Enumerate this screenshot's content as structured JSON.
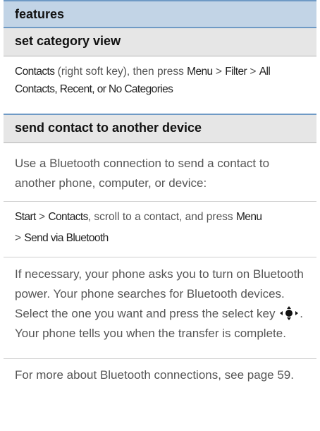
{
  "header": {
    "title": "features"
  },
  "section1": {
    "title": "set category view",
    "line1": {
      "cmd_contacts": "Contacts",
      "t1": " (right soft key), then press ",
      "cmd_menu": "Menu",
      "t2": " > ",
      "cmd_filter": "Filter",
      "t3": " > ",
      "cmd_all": "All"
    },
    "line2": {
      "cmd": "Contacts, Recent, or No Categories"
    }
  },
  "section2": {
    "title": "send contact to another device",
    "p1": "Use a Bluetooth connection to send a contact to another phone, computer, or device:",
    "steps_line1": {
      "cmd_start": "Start",
      "t1": " > ",
      "cmd_contacts": "Contacts",
      "t2": ", scroll to a contact, and press ",
      "cmd_menu": "Menu"
    },
    "steps_line2": {
      "t1": "> ",
      "cmd_send": "Send via Bluetooth"
    },
    "p3_before_icon": "If necessary, your phone asks you to turn on Bluetooth power. Your phone searches for Bluetooth devices. Select the one you want and press the select key ",
    "p3_icon": "select-key-icon",
    "p3_after_icon": ". Your phone tells you when the transfer is complete.",
    "p4": "For more about Bluetooth connections, see page 59."
  }
}
